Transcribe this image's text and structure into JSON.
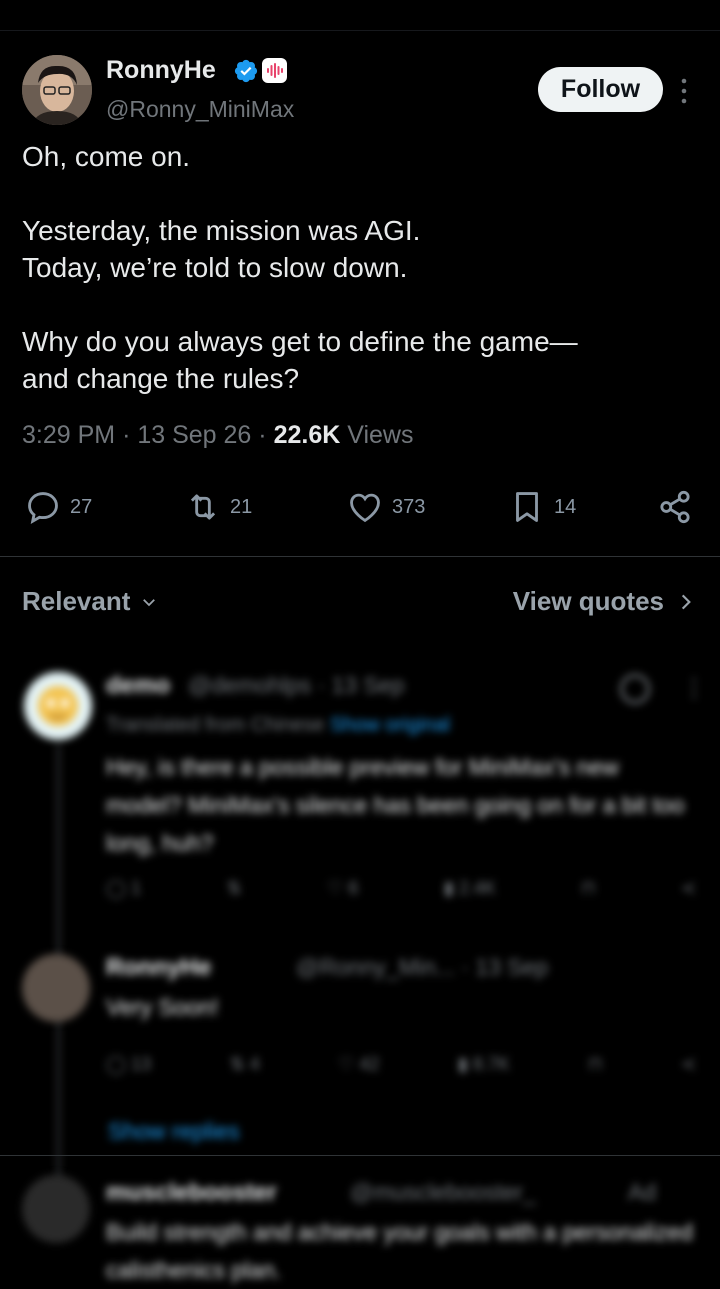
{
  "author": {
    "name": "RonnyHe",
    "handle": "@Ronny_MiniMax",
    "follow_label": "Follow"
  },
  "tweet": {
    "lines": [
      "Oh, come on.",
      "Yesterday, the mission was AGI.\nToday, we’re told to slow down.",
      "Why do you always get to define the game—\nand change the rules?"
    ],
    "time": "3:29 PM",
    "date": "13 Sep 26",
    "views_count": "22.6K",
    "views_label": "Views"
  },
  "actions": {
    "replies": "27",
    "reposts": "21",
    "likes": "373",
    "bookmarks": "14"
  },
  "sort": {
    "relevant_label": "Relevant",
    "view_quotes_label": "View quotes"
  },
  "replies": [
    {
      "name": "demo",
      "handle": "@demohlps · 13 Sep",
      "translated": "Translated from Chinese",
      "show_original": "Show original",
      "text": "Hey, is there a possible preview for MiniMax's new model? MiniMax's silence has been going on for a bit too long, huh?",
      "stats": {
        "replies": "1",
        "likes": "6",
        "views": "2.4K"
      }
    },
    {
      "name": "RonnyHe",
      "handle": "@Ronny_Min... · 13 Sep",
      "text": "Very Soon!",
      "stats": {
        "replies": "13",
        "reposts": "4",
        "likes": "42",
        "views": "8.7K"
      },
      "show_replies": "Show replies"
    },
    {
      "name": "musclebooster",
      "handle": "@musclebooster_",
      "ad_label": "Ad",
      "text": "Build strength and achieve your goals with a personalized calisthenics plan."
    }
  ],
  "colors": {
    "background": "#000000",
    "text": "#e7e9ea",
    "muted": "#71767b",
    "accent": "#1d9bf0"
  }
}
